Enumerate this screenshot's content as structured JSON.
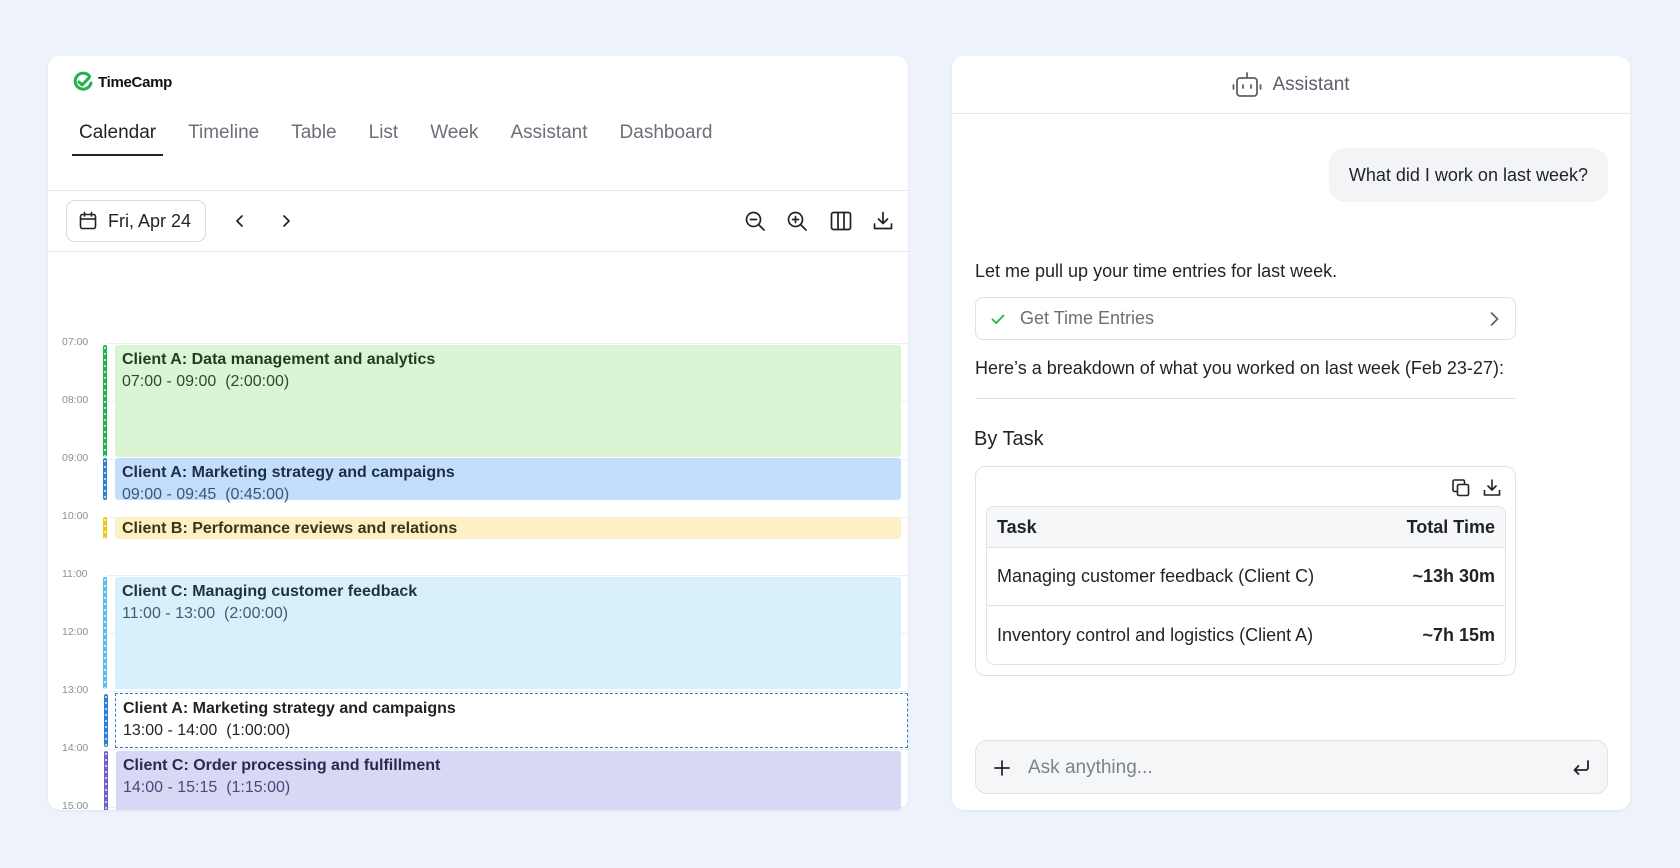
{
  "app": {
    "logo_text": "TimeCamp",
    "brand_color": "#22b14c"
  },
  "tabs": [
    {
      "label": "Calendar",
      "active": true
    },
    {
      "label": "Timeline",
      "active": false
    },
    {
      "label": "Table",
      "active": false
    },
    {
      "label": "List",
      "active": false
    },
    {
      "label": "Week",
      "active": false
    },
    {
      "label": "Assistant",
      "active": false
    },
    {
      "label": "Dashboard",
      "active": false
    }
  ],
  "toolbar": {
    "date_label": "Fri, Apr 24",
    "icons": [
      "calendar-icon",
      "chevron-left-icon",
      "chevron-right-icon",
      "zoom-out-icon",
      "zoom-in-icon",
      "columns-icon",
      "download-icon"
    ]
  },
  "calendar": {
    "hours": [
      "07:00",
      "08:00",
      "09:00",
      "10:00",
      "11:00",
      "12:00",
      "13:00",
      "14:00",
      "15:00"
    ],
    "events": [
      {
        "title": "Client A: Data management and analytics",
        "time": "07:00 - 09:00  (2:00:00)",
        "bg": "#d9f5d3",
        "bar": "#22b14c",
        "text": "#1f3d1f",
        "time_color": "#2d4a2d"
      },
      {
        "title": "Client A: Marketing strategy and campaigns",
        "time": "09:00 - 09:45  (0:45:00)",
        "bg": "#c2defc",
        "bar": "#2f7fd6",
        "text": "#1e2e44",
        "time_color": "#3b5678"
      },
      {
        "title": "Client B: Performance reviews and relations",
        "time": "",
        "bg": "#fdf0c4",
        "bar": "#f0c419",
        "text": "#3d3415",
        "time_color": "#3d3415"
      },
      {
        "title": "Client C: Managing customer feedback",
        "time": "11:00 - 13:00  (2:00:00)",
        "bg": "#d8f0fc",
        "bar": "#5bbde6",
        "text": "#1e3340",
        "time_color": "#3f5f70"
      },
      {
        "title": "Client A: Marketing strategy and campaigns",
        "time": "13:00 - 14:00  (1:00:00)",
        "bg": "#ffffff",
        "bar": "#2f7fd6",
        "text": "#1f2328",
        "time_color": "#1f2328"
      },
      {
        "title": "Client C: Order processing and fulfillment",
        "time": "14:00 - 15:15  (1:15:00)",
        "bg": "#d8d8f4",
        "bar": "#6b63c9",
        "text": "#2a2950",
        "time_color": "#4a4878"
      }
    ]
  },
  "assistant": {
    "header_title": "Assistant",
    "user_message": "What did I work on last week?",
    "intro_text": "Let me pull up your time entries for last week.",
    "tool_call_label": "Get Time Entries",
    "breakdown_text": "Here’s a breakdown of what you worked on last week (Feb 23-27):",
    "section_title": "By Task",
    "table": {
      "headers": [
        "Task",
        "Total Time"
      ],
      "rows": [
        [
          "Managing customer feedback (Client C)",
          "~13h 30m"
        ],
        [
          "Inventory control and logistics (Client A)",
          "~7h 15m"
        ]
      ]
    },
    "input_placeholder": "Ask anything..."
  }
}
